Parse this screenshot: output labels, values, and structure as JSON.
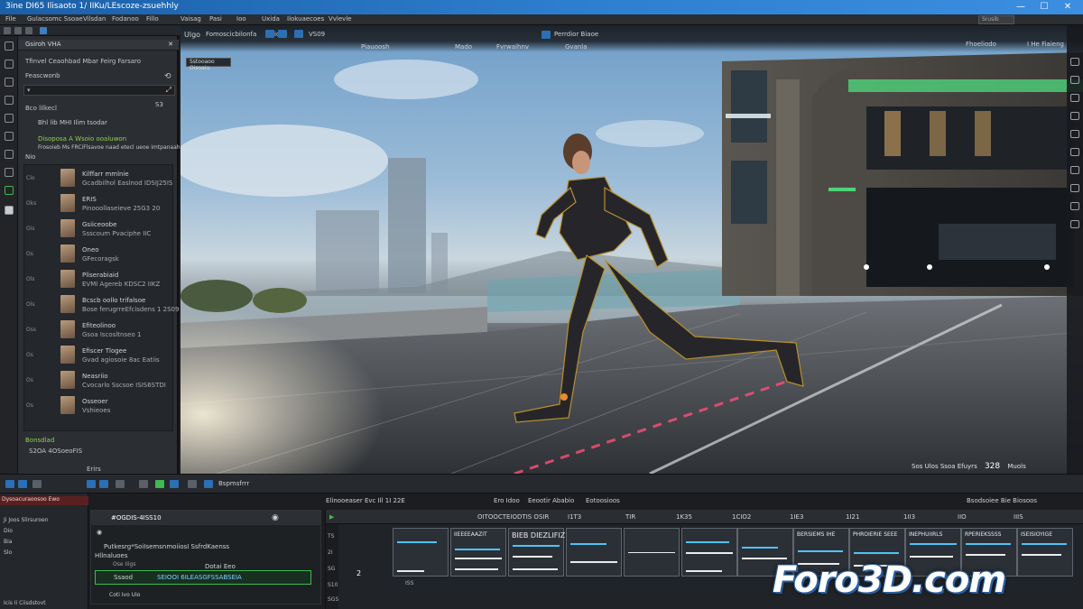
{
  "window": {
    "title": "3ine DI65 Ilisaoto 1/ IIKu/LEscoze-zsuehhly"
  },
  "menu": {
    "items": [
      "File",
      "Gulacsomc Ssoae",
      "Vilsdan",
      "Fodanoo",
      "Fillo",
      "Vaisag",
      "Pasi",
      "Ioo",
      "Uxida",
      "Ilokuaecoes",
      "Vvlevle"
    ],
    "search_placeholder": "Srusib"
  },
  "asset_panel": {
    "header": "Gsiroh VHA",
    "line1": "Tfinvel Ceaohbad Mbar Feirg Farsaro",
    "line2": "Feascwonb",
    "search_placeholder": "",
    "section_label": "Bco lilkecl",
    "section_count": "S3",
    "sub_line": "Bhl lib MHI Ilim tsodar",
    "green_line": "Disoposa A Wsoio ooaluwon",
    "desc_line": "Frosoieb Ms FRCiFlsavoe naad etecl ueoe imtpanaahing",
    "filter_label": "Nio",
    "items": [
      {
        "idx": "Clo",
        "name": "Kilffarr mmlnie",
        "sub": "Gcadbilhol Easlnod IDSIJ25IS"
      },
      {
        "idx": "Oks",
        "name": "ERIS",
        "sub": "Pinooollaseieve 25G3 20"
      },
      {
        "idx": "Ois",
        "name": "Gsiiceoobe",
        "sub": "Ssscoum Pvaciphe IIC"
      },
      {
        "idx": "Os",
        "name": "Oneo",
        "sub": "GFecoragsk"
      },
      {
        "idx": "Ols",
        "name": "Pliserabiaid",
        "sub": "EVMI Agereb KDSC2 IIKZ"
      },
      {
        "idx": "Ols",
        "name": "Bcscb oollo trifalsoe",
        "sub": "Bose ferugrreEfcisdens 1 2S09"
      },
      {
        "idx": "Oss",
        "name": "Efiteolinoo",
        "sub": "Gsoa Iscosltnseo 1"
      },
      {
        "idx": "Os",
        "name": "Efiscer Tlogee",
        "sub": "Gvad agiosoie 8ac Eatiis"
      },
      {
        "idx": "Os",
        "name": "Neasriio",
        "sub": "Cvocarlo Sscsoe ISIS6STDI"
      },
      {
        "idx": "Os",
        "name": "Osseoer",
        "sub": "Vshieoes"
      }
    ],
    "footer_green": "Bonsdlad",
    "footer_line": "S2OA 4OSoeoFIS",
    "footer_button": "Erirs"
  },
  "viewport": {
    "title": "Ulgo",
    "mode_label": "Fomoscicbilonfa",
    "camera_label": "Ilios",
    "perspective": "VS09",
    "lit_label": "Piauoosh",
    "snap_label": "Mado",
    "grid_label": "Fvrwaihnv",
    "angle_label": "Gvanla",
    "play_label": "Perrdior Biaoe",
    "right_label": "Fhoeliodo",
    "right_label2": "I He Fiaieng",
    "overlay_label": "Sstooaoo Oisoaiu",
    "status_left": "Sos",
    "status_text": "Ulos Ssoa Efuyrs",
    "status_value": "328",
    "status_right": "Muols"
  },
  "bottom_bar": {
    "label": "Bspmsfrrr"
  },
  "outliner": {
    "header": "Dysoacuraoosoo Ewo",
    "rows": [
      "Ji  Joos  Slirsuroen",
      "Dio",
      "Bia",
      "Slo"
    ],
    "foot": "Icis  Ii  Ciisdstovt"
  },
  "details": {
    "code": "#OGDIS-4ISS10",
    "line1": "Putkesrg*SoiIsemsnmoiiosI SsfrdKaenss",
    "line2": "Hllnaluoes",
    "line3": "Ose Iiigs",
    "line4": "Dotai Eeo",
    "sel_code": "Ssaod",
    "sel_text": "SEIOOI 6ILEASGFSSABSEIA",
    "foot": "Coti Ivo  Uio"
  },
  "sequencer": {
    "tabs": [
      "Elinooeaser Evc Ill 1I 22E",
      "Ero Idoo",
      "Eeootir Ababio",
      "Eotoosioos"
    ],
    "right_label": "Bsodsoiee Bie Biosoos",
    "timeline_label": "OITOOCTEIODTIS OSIR",
    "ticks": [
      "I1T3",
      "TIR",
      "1K35",
      "1CIO2",
      "1IE3",
      "1I21",
      "1II3",
      "IIO",
      "IIIS"
    ],
    "clips": [
      "",
      "IIEEEEAAZIT",
      "BIEB DIEZLIFIZ",
      "",
      "",
      "",
      "",
      "BERSIEMS IHE",
      "PHROIERIE SEEE",
      "INEPHUIIRLS",
      "RPERIEKSSSS",
      "ISEISIOYIGE"
    ],
    "track_labels": [
      "TS",
      "2I",
      "SG",
      "S10",
      "SGS"
    ],
    "frame": "2",
    "foot": "ISS"
  },
  "watermark": "Foro3D.com"
}
